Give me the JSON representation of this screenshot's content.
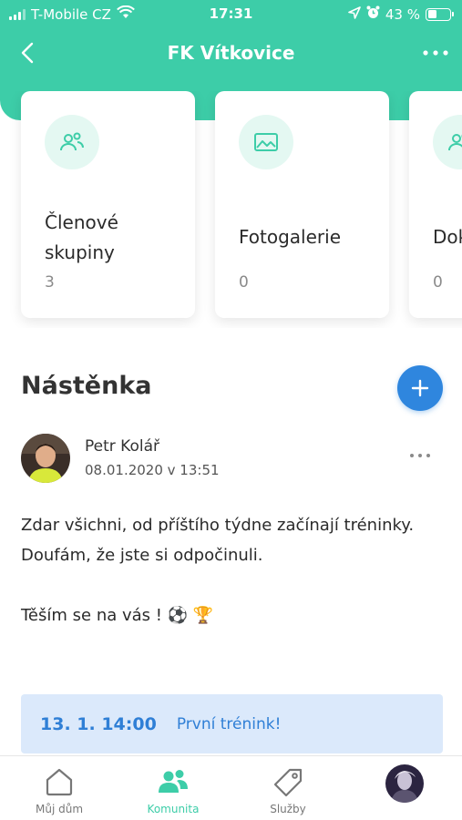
{
  "status_bar": {
    "carrier": "T-Mobile CZ",
    "time": "17:31",
    "battery": "43 %",
    "battery_level": 0.43,
    "icons": [
      "signal-icon",
      "wifi-icon",
      "location-icon",
      "alarm-icon",
      "battery-icon"
    ]
  },
  "header": {
    "title": "FK Vítkovice",
    "back_icon": "chevron-left-icon",
    "more_icon": "more-horizontal-icon"
  },
  "cards": [
    {
      "label": "Členové skupiny",
      "count": "3",
      "icon": "group-icon"
    },
    {
      "label": "Fotogalerie",
      "count": "0",
      "icon": "image-icon"
    },
    {
      "label": "Dok",
      "count": "0",
      "icon": "group-icon"
    }
  ],
  "wall": {
    "title": "Nástěnka",
    "add_icon": "plus-icon"
  },
  "post": {
    "author": "Petr Kolář",
    "date": "08.01.2020 v 13:51",
    "lines": [
      "Zdar všichni, od příštího týdne začínají tréninky.",
      "Doufám, že jste si odpočinuli.",
      "",
      "Těším se na vás ! ⚽ 🏆"
    ]
  },
  "event": {
    "date": "13. 1. 14:00",
    "title": "První trénink!"
  },
  "tabbar": {
    "items": [
      {
        "label": "Můj dům",
        "icon": "home-icon",
        "active": false
      },
      {
        "label": "Komunita",
        "icon": "community-icon",
        "active": true
      },
      {
        "label": "Služby",
        "icon": "tag-icon",
        "active": false
      },
      {
        "label": "",
        "icon": "profile-avatar",
        "active": false
      }
    ]
  },
  "colors": {
    "accent": "#3dcda8",
    "accent_light": "#e4f8f2",
    "primary_button": "#2f86de",
    "event_bg": "#dbe9fb",
    "event_text": "#2f7fd6"
  }
}
